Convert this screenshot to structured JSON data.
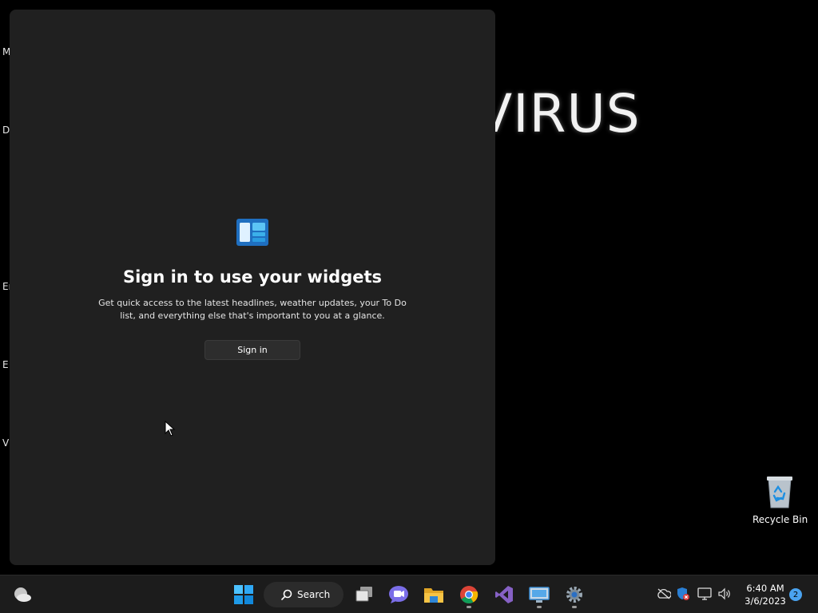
{
  "desktop": {
    "edge_labels": [
      "M",
      "D",
      "Er",
      "E",
      "V"
    ],
    "wallpaper_text": "VIRUS",
    "recycle_bin_label": "Recycle Bin"
  },
  "widgets": {
    "title": "Sign in to use your widgets",
    "description": "Get quick access to the latest headlines, weather updates, your To Do list, and everything else that's important to you at a glance.",
    "signin_label": "Sign in"
  },
  "taskbar": {
    "search_label": "Search",
    "pinned": [
      "weather-icon",
      "start-icon",
      "search-icon",
      "task-view-icon",
      "chat-icon",
      "file-explorer-icon",
      "chrome-icon",
      "visual-studio-icon",
      "remote-desktop-icon",
      "settings-icon"
    ],
    "tray": [
      "cloud-offline-icon",
      "security-icon",
      "network-icon",
      "volume-icon"
    ],
    "time": "6:40 AM",
    "date": "3/6/2023",
    "notification_count": "2"
  },
  "colors": {
    "panel_bg": "#202020",
    "taskbar_bg": "#1c1c1c",
    "accent": "#0078d4",
    "badge": "#4aa3f0"
  }
}
